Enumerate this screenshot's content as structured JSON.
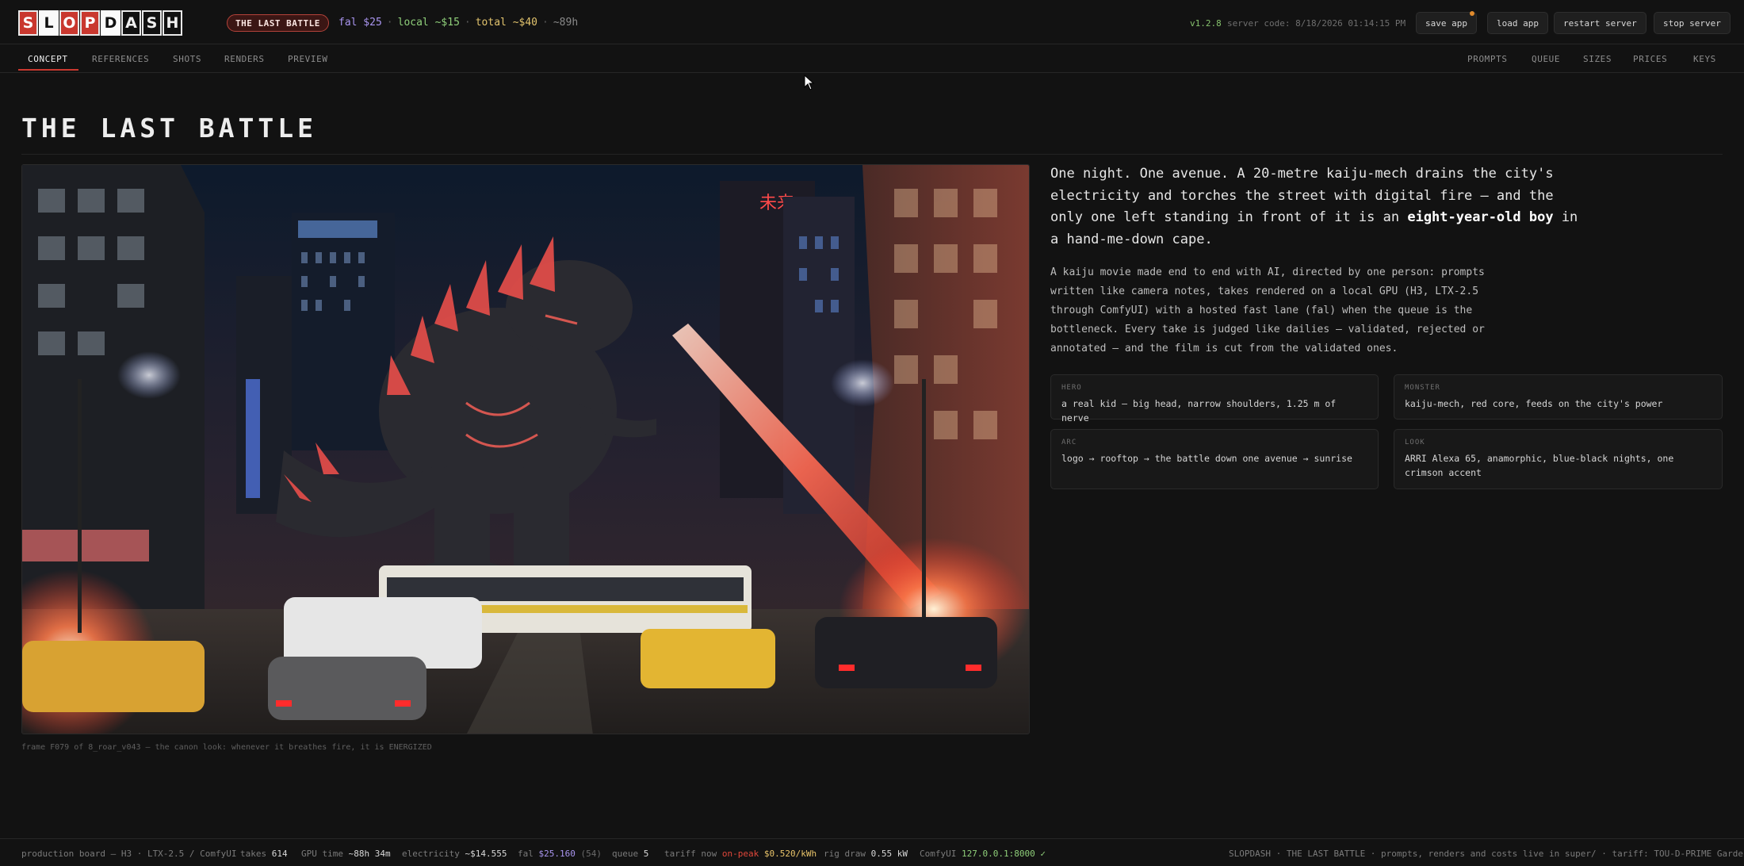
{
  "app": {
    "logo_letters": [
      "S",
      "L",
      "O",
      "P",
      "D",
      "A",
      "S",
      "H"
    ],
    "project_badge": "THE LAST BATTLE",
    "costs": {
      "fal": "fal $25",
      "local": "local ~$15",
      "total": "total ~$40",
      "hours": "~89h"
    },
    "version": "v1.2.8",
    "server_code": "server code: 8/18/2026 01:14:15 PM",
    "buttons": {
      "save": "save app",
      "load": "load app",
      "restart": "restart server",
      "stop": "stop server"
    }
  },
  "nav": {
    "left": [
      "CONCEPT",
      "REFERENCES",
      "SHOTS",
      "RENDERS",
      "PREVIEW"
    ],
    "right": [
      "PROMPTS",
      "QUEUE",
      "SIZES",
      "PRICES",
      "KEYS"
    ],
    "active": "CONCEPT"
  },
  "page": {
    "title": "THE LAST BATTLE",
    "caption": "frame F079 of 8_roar_v043 — the canon look: whenever it breathes fire, it is ENERGIZED",
    "logline": {
      "before": "One night. One avenue. A 20-metre kaiju-mech drains the city's electricity and torches the street with digital fire — and the only one left standing in front of it is an ",
      "bold": "eight-year-old boy",
      "after": " in a hand-me-down cape."
    },
    "blurb": "A kaiju movie made end to end with AI, directed by one person: prompts written like camera notes, takes rendered on a local GPU (H3, LTX-2.5 through ComfyUI) with a hosted fast lane (fal) when the queue is the bottleneck. Every take is judged like dailies — validated, rejected or annotated — and the film is cut from the validated ones.",
    "cards": [
      {
        "key": "HERO",
        "value": "a real kid — big head, narrow shoulders, 1.25 m of nerve"
      },
      {
        "key": "MONSTER",
        "value": "kaiju-mech, red core, feeds on the city's power"
      },
      {
        "key": "ARC",
        "value": "logo → rooftop → the battle down one avenue → sunrise"
      },
      {
        "key": "LOOK",
        "value": "ARRI Alexa 65, anamorphic, blue-black nights, one crimson accent"
      }
    ],
    "sign_text": "未来"
  },
  "status": {
    "board": "production board — H3 · LTX-2.5 / ComfyUI",
    "takes_label": "takes",
    "takes": "614",
    "gpu_label": "GPU time",
    "gpu": "~88h 34m",
    "elec_label": "electricity",
    "elec": "~$14.555",
    "fal_label": "fal",
    "fal": "$25.160",
    "fal_count": "(54)",
    "queue_label": "queue",
    "queue": "5",
    "tariff_label": "tariff now",
    "tariff_peak": "on-peak",
    "tariff_rate": "$0.520/kWh",
    "rig_label": "rig draw",
    "rig": "0.55 kW",
    "comfy_label": "ComfyUI",
    "comfy": "127.0.0.1:8000 ✓",
    "right": "SLOPDASH · THE LAST BATTLE · prompts, renders and costs live in super/ · tariff: TOU-D-PRIME Gardena"
  },
  "colors": {
    "accent": "#c9382f",
    "fal": "#a995ef",
    "local": "#8fcf7a",
    "total": "#e2c36d",
    "peak": "#e0473a"
  }
}
